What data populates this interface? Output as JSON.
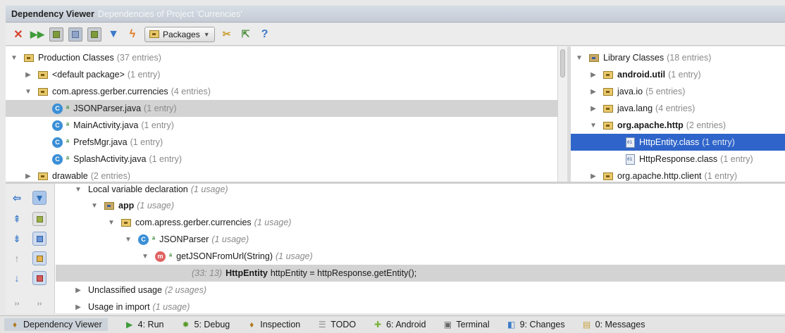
{
  "window": {
    "title": "Dependency Viewer",
    "subtitle": "Dependencies of Project 'Currencies'"
  },
  "toolbar": {
    "scope_dropdown": "Packages",
    "help_label": "?"
  },
  "production": {
    "root_label": "Production Classes",
    "root_count": "(37 entries)",
    "items": [
      {
        "label": "<default package>",
        "count": "(1 entry)"
      },
      {
        "label": "com.apress.gerber.currencies",
        "count": "(4 entries)"
      },
      {
        "label": "JSONParser.java",
        "count": "(1 entry)"
      },
      {
        "label": "MainActivity.java",
        "count": "(1 entry)"
      },
      {
        "label": "PrefsMgr.java",
        "count": "(1 entry)"
      },
      {
        "label": "SplashActivity.java",
        "count": "(1 entry)"
      },
      {
        "label": "drawable",
        "count": "(2 entries)"
      }
    ]
  },
  "library": {
    "root_label": "Library Classes",
    "root_count": "(18 entries)",
    "items": [
      {
        "label": "android.util",
        "count": "(1 entry)"
      },
      {
        "label": "java.io",
        "count": "(5 entries)"
      },
      {
        "label": "java.lang",
        "count": "(4 entries)"
      },
      {
        "label": "org.apache.http",
        "count": "(2 entries)"
      },
      {
        "label": "HttpEntity.class",
        "count": "(1 entry)"
      },
      {
        "label": "HttpResponse.class",
        "count": "(1 entry)"
      },
      {
        "label": "org.apache.http.client",
        "count": "(1 entry)"
      }
    ]
  },
  "usages": {
    "partial_header": "Local variable declaration",
    "partial_header_count": "(1 usage)",
    "app": {
      "label": "app",
      "count": "(1 usage)"
    },
    "package": {
      "label": "com.apress.gerber.currencies",
      "count": "(1 usage)"
    },
    "class": {
      "label": "JSONParser",
      "count": "(1 usage)"
    },
    "method": {
      "label": "getJSONFromUrl(String)",
      "count": "(1 usage)"
    },
    "code_line": {
      "location": "(33: 13)",
      "keyword": "HttpEntity",
      "rest": "httpEntity = httpResponse.getEntity();"
    },
    "unclassified": {
      "label": "Unclassified usage",
      "count": "(2 usages)"
    },
    "import": {
      "label": "Usage in import",
      "count": "(1 usage)"
    }
  },
  "statusbar": {
    "items": [
      {
        "label": "Dependency Viewer"
      },
      {
        "label": "4: Run"
      },
      {
        "label": "5: Debug"
      },
      {
        "label": "Inspection"
      },
      {
        "label": "TODO"
      },
      {
        "label": "6: Android"
      },
      {
        "label": "Terminal"
      },
      {
        "label": "9: Changes"
      },
      {
        "label": "0: Messages"
      }
    ]
  }
}
